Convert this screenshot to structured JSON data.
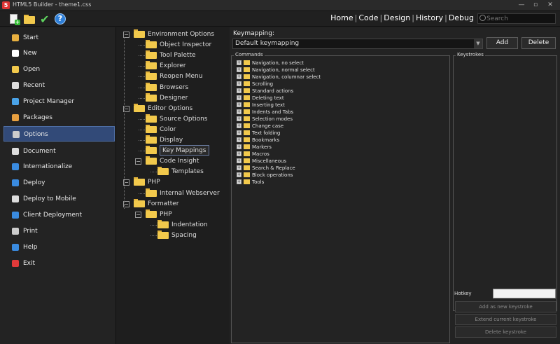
{
  "window": {
    "title": "HTML5 Builder - theme1.css"
  },
  "topnav": {
    "items": [
      "Home",
      "Code",
      "Design",
      "History",
      "Debug"
    ],
    "search_placeholder": "Search"
  },
  "sidebar": {
    "items": [
      {
        "label": "Start",
        "color": "#e8b040"
      },
      {
        "label": "New",
        "color": "#ffffff"
      },
      {
        "label": "Open",
        "color": "#f2c94c"
      },
      {
        "label": "Recent",
        "color": "#dddddd"
      },
      {
        "label": "Project Manager",
        "color": "#4aa3e8"
      },
      {
        "label": "Packages",
        "color": "#e8a040"
      },
      {
        "label": "Options",
        "color": "#cccccc"
      },
      {
        "label": "Document",
        "color": "#dddddd"
      },
      {
        "label": "Internationalize",
        "color": "#3a8be0"
      },
      {
        "label": "Deploy",
        "color": "#3a8be0"
      },
      {
        "label": "Deploy to Mobile",
        "color": "#dddddd"
      },
      {
        "label": "Client Deployment",
        "color": "#3a8be0"
      },
      {
        "label": "Print",
        "color": "#cccccc"
      },
      {
        "label": "Help",
        "color": "#3a8be0"
      },
      {
        "label": "Exit",
        "color": "#e03a3a"
      }
    ],
    "active": "Options"
  },
  "tree": {
    "nodes": [
      {
        "label": "Environment Options",
        "level": 0,
        "expander": "−"
      },
      {
        "label": "Object Inspector",
        "level": 1
      },
      {
        "label": "Tool Palette",
        "level": 1
      },
      {
        "label": "Explorer",
        "level": 1
      },
      {
        "label": "Reopen Menu",
        "level": 1
      },
      {
        "label": "Browsers",
        "level": 1
      },
      {
        "label": "Designer",
        "level": 1
      },
      {
        "label": "Editor Options",
        "level": 0,
        "expander": "−"
      },
      {
        "label": "Source Options",
        "level": 1
      },
      {
        "label": "Color",
        "level": 1
      },
      {
        "label": "Display",
        "level": 1
      },
      {
        "label": "Key Mappings",
        "level": 1,
        "selected": true
      },
      {
        "label": "Code Insight",
        "level": 1,
        "expander": "−"
      },
      {
        "label": "Templates",
        "level": 2
      },
      {
        "label": "PHP",
        "level": 0,
        "expander": "−"
      },
      {
        "label": "Internal Webserver",
        "level": 1
      },
      {
        "label": "Formatter",
        "level": 0,
        "expander": "−"
      },
      {
        "label": "PHP",
        "level": 1,
        "expander": "−"
      },
      {
        "label": "Indentation",
        "level": 2
      },
      {
        "label": "Spacing",
        "level": 2
      }
    ]
  },
  "keymapping": {
    "label": "Keymapping:",
    "selected": "Default keymapping",
    "add_label": "Add",
    "delete_label": "Delete"
  },
  "commands": {
    "title": "Commands",
    "items": [
      "Navigation, no select",
      "Navigation, normal select",
      "Navigation, columnar select",
      "Scrolling",
      "Standard actions",
      "Deleting text",
      "Inserting text",
      "Indents and Tabs",
      "Selection modes",
      "Change case",
      "Text folding",
      "Bookmarks",
      "Markers",
      "Macros",
      "Miscellaneous",
      "Search & Replace",
      "Block operations",
      "Tools"
    ]
  },
  "keystrokes": {
    "title": "Keystrokes",
    "hotkey_label": "Hotkey",
    "add_new_label": "Add as new keystroke",
    "extend_label": "Extend current keystroke",
    "delete_label": "Delete keystroke"
  }
}
